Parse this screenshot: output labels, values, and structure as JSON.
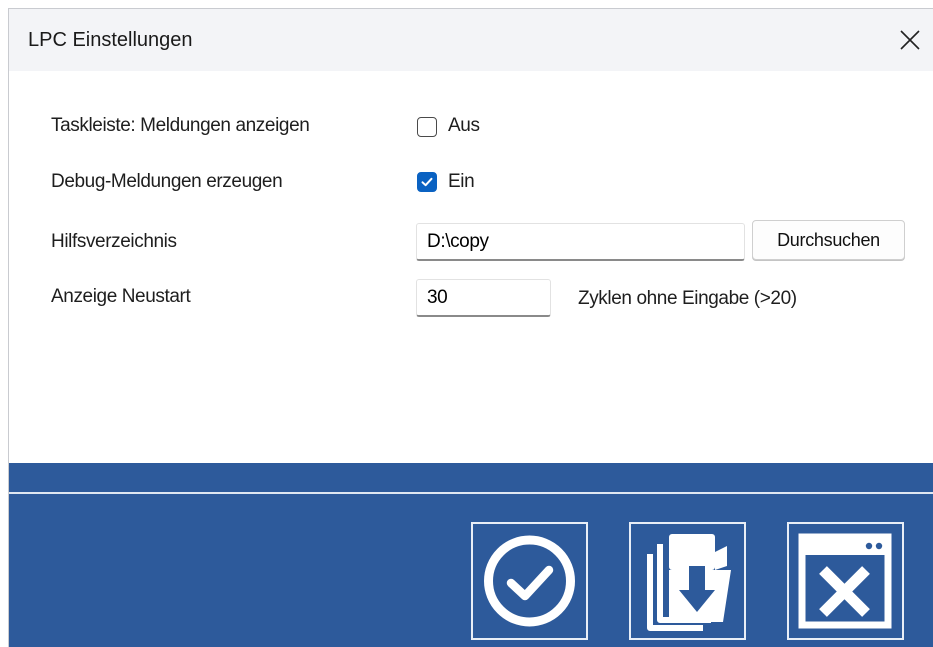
{
  "window": {
    "title": "LPC Einstellungen"
  },
  "settings": {
    "taskbar": {
      "label": "Taskleiste: Meldungen anzeigen",
      "checkbox_label": "Aus",
      "checked": false
    },
    "debug": {
      "label": "Debug-Meldungen erzeugen",
      "checkbox_label": "Ein",
      "checked": true
    },
    "helpdir": {
      "label": "Hilfsverzeichnis",
      "value": "D:\\copy",
      "browse_label": "Durchsuchen"
    },
    "restart": {
      "label": "Anzeige Neustart",
      "value": "30",
      "hint": "Zyklen ohne Eingabe (>20)"
    }
  },
  "footer": {
    "buttons": [
      {
        "icon": "checkmark-circle-icon"
      },
      {
        "icon": "import-documents-icon"
      },
      {
        "icon": "close-window-icon"
      }
    ]
  },
  "colors": {
    "footer_bg": "#2d5a9b",
    "checkbox_accent": "#0a62c2",
    "titlebar_bg": "#f3f4f7"
  }
}
